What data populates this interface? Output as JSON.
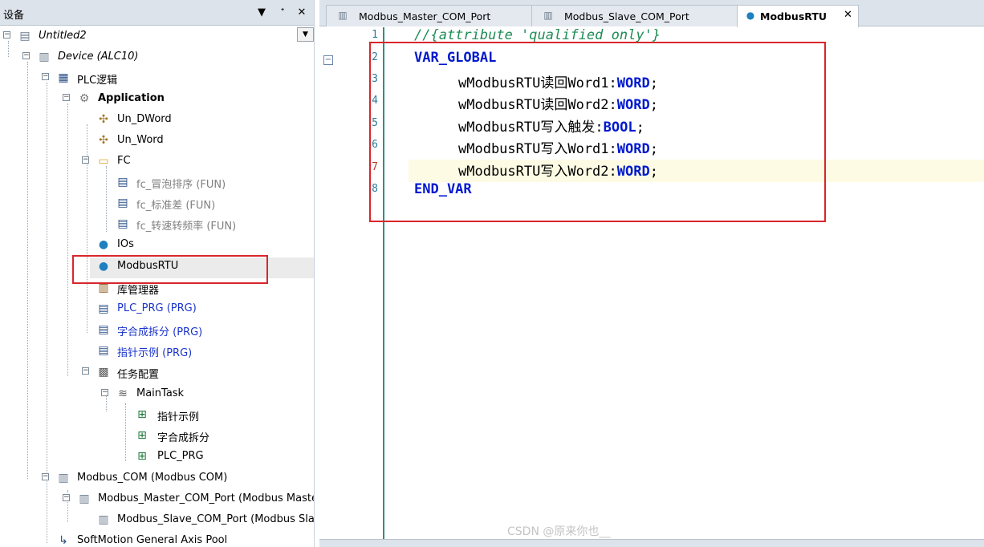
{
  "left_panel": {
    "title": "设备",
    "pin_button": "▼",
    "dock_button": "ᐩ",
    "close_button": "✕"
  },
  "tree": [
    {
      "label": "Untitled2"
    },
    {
      "label": "Device (ALC10)"
    },
    {
      "label": "PLC逻辑"
    },
    {
      "label": "Application"
    },
    {
      "label": "Un_DWord"
    },
    {
      "label": "Un_Word"
    },
    {
      "label": "FC"
    },
    {
      "label": "fc_冒泡排序 (FUN)"
    },
    {
      "label": "fc_标准差 (FUN)"
    },
    {
      "label": "fc_转速转频率 (FUN)"
    },
    {
      "label": "IOs"
    },
    {
      "label": "ModbusRTU"
    },
    {
      "label": "库管理器"
    },
    {
      "label": "PLC_PRG (PRG)"
    },
    {
      "label": "字合成拆分 (PRG)"
    },
    {
      "label": "指针示例 (PRG)"
    },
    {
      "label": "任务配置"
    },
    {
      "label": "MainTask"
    },
    {
      "label": "指针示例"
    },
    {
      "label": "字合成拆分"
    },
    {
      "label": "PLC_PRG"
    },
    {
      "label": "Modbus_COM (Modbus COM)"
    },
    {
      "label": "Modbus_Master_COM_Port (Modbus Master,"
    },
    {
      "label": "Modbus_Slave_COM_Port (Modbus Slave"
    },
    {
      "label": "SoftMotion General Axis Pool"
    }
  ],
  "tabs": [
    {
      "label": "Modbus_Master_COM_Port"
    },
    {
      "label": "Modbus_Slave_COM_Port"
    },
    {
      "label": "ModbusRTU"
    }
  ],
  "editor": {
    "line_numbers": [
      "1",
      "2",
      "3",
      "4",
      "5",
      "6",
      "7",
      "8"
    ],
    "lines": {
      "l1": "//{attribute 'qualified_only'}",
      "l2": "VAR_GLOBAL",
      "l3_name": "wModbusRTU读回Word1",
      "l3_type": "WORD",
      "l4_name": "wModbusRTU读回Word2",
      "l4_type": "WORD",
      "l5_name": "wModbusRTU写入触发",
      "l5_type": "BOOL",
      "l6_name": "wModbusRTU写入Word1",
      "l6_type": "WORD",
      "l7_name": "wModbusRTU写入Word2",
      "l7_type": "WORD",
      "l8": "END_VAR"
    }
  },
  "watermark": "CSDN @原来你也__"
}
